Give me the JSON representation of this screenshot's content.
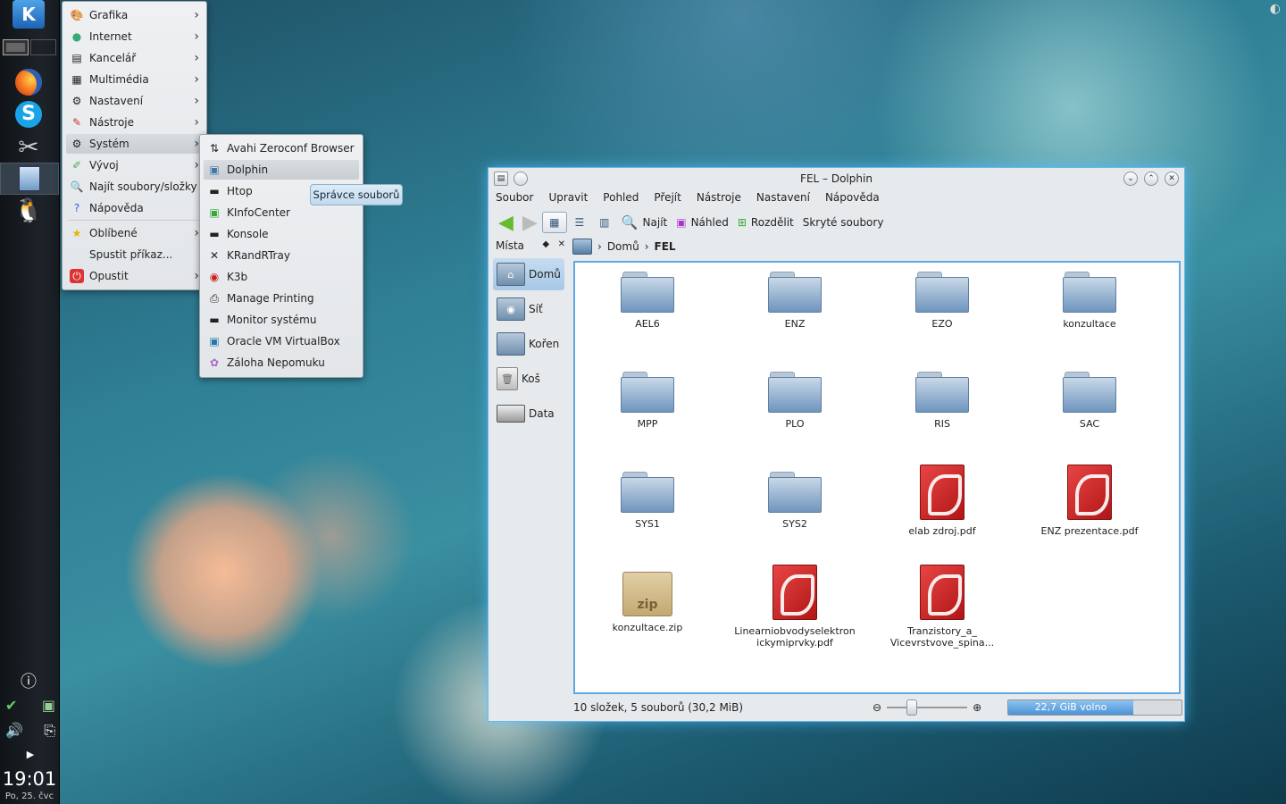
{
  "panel": {
    "clock": "19:01",
    "date": "Po, 25. čvc"
  },
  "kickoff_menu": {
    "items": [
      {
        "label": "Grafika",
        "icon": "graphics-icon"
      },
      {
        "label": "Internet",
        "icon": "globe-icon"
      },
      {
        "label": "Kancelář",
        "icon": "office-icon"
      },
      {
        "label": "Multimédia",
        "icon": "multimedia-icon"
      },
      {
        "label": "Nastavení",
        "icon": "settings-icon"
      },
      {
        "label": "Nástroje",
        "icon": "tools-icon"
      },
      {
        "label": "Systém",
        "icon": "system-icon"
      },
      {
        "label": "Vývoj",
        "icon": "development-icon"
      },
      {
        "label": "Najít soubory/složky",
        "icon": "search-icon"
      },
      {
        "label": "Nápověda",
        "icon": "help-icon"
      },
      {
        "label": "Oblíbené",
        "icon": "star-icon"
      },
      {
        "label": "Spustit příkaz...",
        "icon": "run-icon"
      },
      {
        "label": "Opustit",
        "icon": "power-icon"
      }
    ]
  },
  "system_submenu": {
    "items": [
      {
        "label": "Avahi Zeroconf Browser"
      },
      {
        "label": "Dolphin"
      },
      {
        "label": "Htop"
      },
      {
        "label": "KInfoCenter"
      },
      {
        "label": "Konsole"
      },
      {
        "label": "KRandRTray"
      },
      {
        "label": "K3b"
      },
      {
        "label": "Manage Printing"
      },
      {
        "label": "Monitor systému"
      },
      {
        "label": "Oracle VM VirtualBox"
      },
      {
        "label": "Záloha Nepomuku"
      }
    ],
    "tooltip": "Správce souborů"
  },
  "dolphin": {
    "title": "FEL – Dolphin",
    "menubar": [
      "Soubor",
      "Upravit",
      "Pohled",
      "Přejít",
      "Nástroje",
      "Nastavení",
      "Nápověda"
    ],
    "toolbar": {
      "find": "Najít",
      "preview": "Náhled",
      "split": "Rozdělit",
      "hidden": "Skryté soubory"
    },
    "places": {
      "title": "Místa",
      "items": [
        "Domů",
        "Síť",
        "Kořen",
        "Koš",
        "Data"
      ]
    },
    "breadcrumb": [
      "Domů",
      "FEL"
    ],
    "files": [
      {
        "name": "AEL6",
        "type": "folder"
      },
      {
        "name": "ENZ",
        "type": "folder"
      },
      {
        "name": "EZO",
        "type": "folder"
      },
      {
        "name": "konzultace",
        "type": "folder"
      },
      {
        "name": "MPP",
        "type": "folder"
      },
      {
        "name": "PLO",
        "type": "folder"
      },
      {
        "name": "RIS",
        "type": "folder"
      },
      {
        "name": "SAC",
        "type": "folder"
      },
      {
        "name": "SYS1",
        "type": "folder"
      },
      {
        "name": "SYS2",
        "type": "folder"
      },
      {
        "name": "elab zdroj.pdf",
        "type": "pdf"
      },
      {
        "name": "ENZ prezentace.pdf",
        "type": "pdf"
      },
      {
        "name": "konzultace.zip",
        "type": "zip",
        "icon_text": "zip"
      },
      {
        "name": "Linearniobvodyselektron ickymiprvky.pdf",
        "type": "pdf"
      },
      {
        "name": "Tranzistory_a_ Vicevrstvove_spina...",
        "type": "pdf"
      }
    ],
    "status": "10 složek, 5 souborů (30,2 MiB)",
    "free_space": "22,7 GiB volno",
    "free_space_used_fraction": 0.72
  },
  "colors": {
    "window_glow": "#6ab7e8",
    "view_border": "#5ea9e4"
  }
}
